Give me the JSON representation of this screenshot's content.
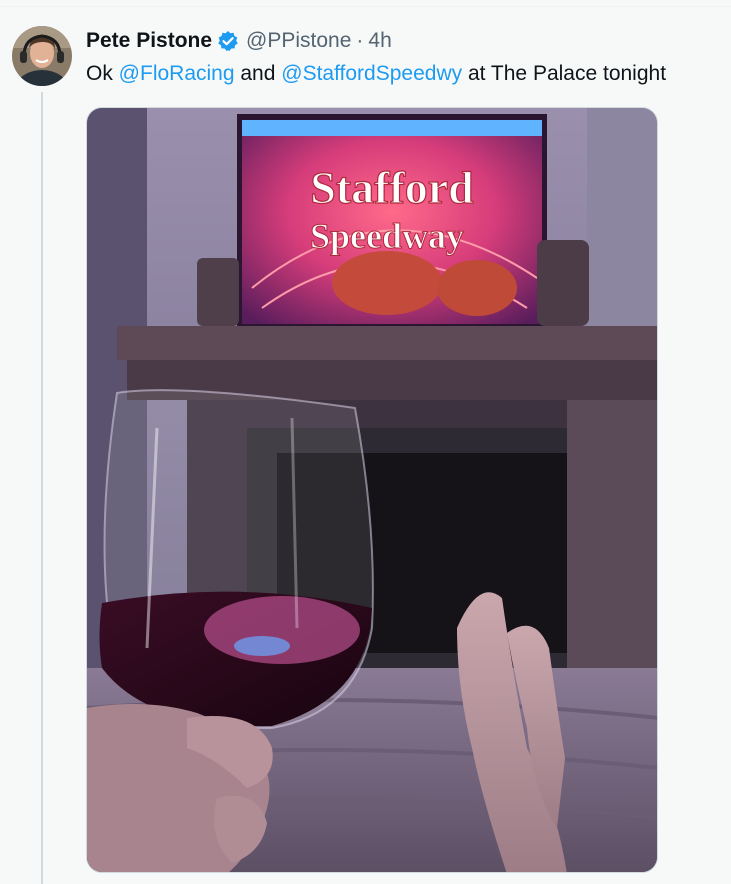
{
  "tweet": {
    "author": {
      "name": "Pete Pistone",
      "handle": "@PPistone",
      "verified": true,
      "verified_color": "#1d9bf0"
    },
    "separator": "·",
    "time": "4h",
    "text": {
      "part1": "Ok ",
      "mention1": "@FloRacing",
      "part2": " and ",
      "mention2": "@StaffordSpeedwy",
      "part3": " at The Palace tonight"
    },
    "media": {
      "tv_line1": "Stafford",
      "tv_line2": "Speedway"
    }
  },
  "colors": {
    "text": "#0f1419",
    "secondary": "#536471",
    "link": "#1d9bf0",
    "thread_line": "#cfd9de",
    "background": "#f7f9f9"
  },
  "icons": [
    "verified-badge-icon"
  ]
}
